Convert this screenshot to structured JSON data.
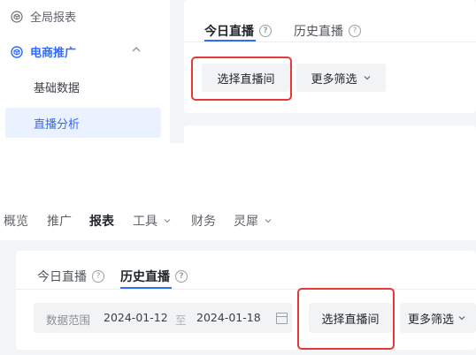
{
  "top": {
    "sidebar": {
      "items": [
        {
          "label": "全局报表",
          "icon": "cube-icon"
        },
        {
          "label": "电商推广",
          "icon": "cube-icon"
        }
      ],
      "subitems": [
        {
          "label": "基础数据"
        },
        {
          "label": "直播分析"
        }
      ]
    },
    "tabs": [
      {
        "label": "今日直播",
        "help": "?"
      },
      {
        "label": "历史直播",
        "help": "?"
      }
    ],
    "buttons": {
      "select_live_room": "选择直播间",
      "more_filters": "更多筛选"
    }
  },
  "bottom": {
    "nav": [
      "概览",
      "推广",
      "报表",
      "工具",
      "财务",
      "灵犀"
    ],
    "tabs": [
      {
        "label": "今日直播",
        "help": "?"
      },
      {
        "label": "历史直播",
        "help": "?"
      }
    ],
    "date_range": {
      "label": "数据范围",
      "start": "2024-01-12",
      "separator": "至",
      "end": "2024-01-18"
    },
    "buttons": {
      "select_live_room": "选择直播间",
      "more_filters": "更多筛选"
    }
  },
  "colors": {
    "accent": "#2f6bff",
    "highlight": "#e53935",
    "panel_bg": "#f4f5f7"
  }
}
